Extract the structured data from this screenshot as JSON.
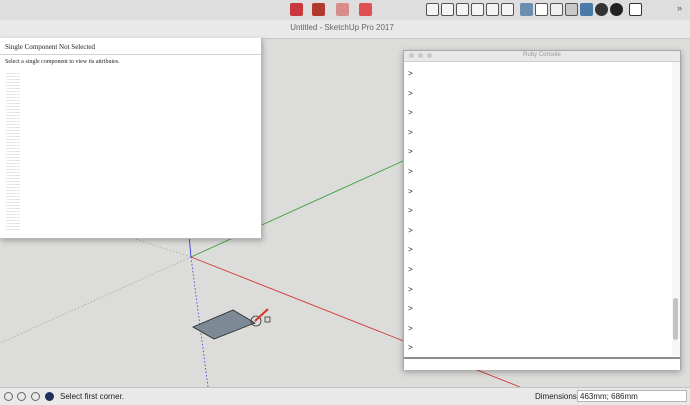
{
  "window": {
    "title": "Untitled - SketchUp Pro 2017"
  },
  "toolbar": {
    "icons": [
      "extension-warehouse-icon",
      "component-icon",
      "3d-warehouse-icon",
      "send-to-layout-icon",
      "iso-view-icon",
      "top-view-icon",
      "front-view-icon",
      "right-view-icon",
      "back-view-icon",
      "left-view-icon",
      "xray-icon",
      "wireframe-icon",
      "hidden-line-icon",
      "shaded-icon",
      "shaded-textures-icon",
      "monochrome-icon",
      "shadow-icon"
    ]
  },
  "attributes_panel": {
    "title": "Single Component Not Selected",
    "message": "Select a single component to view its attributes."
  },
  "ruby_console": {
    "title": "Ruby Console",
    "prompts": [
      ">",
      ">",
      ">",
      ">",
      ">",
      ">",
      ">",
      ">",
      ">",
      ">",
      ">",
      ">",
      ">",
      ">",
      ">"
    ]
  },
  "status_bar": {
    "message": "Select first corner.",
    "dimensions_label": "Dimensions",
    "dimensions_value": "463mm; 686mm"
  },
  "colors": {
    "x_axis": "#d33a3a",
    "y_axis": "#3fa03f",
    "z_axis": "#3a3ad8",
    "rectangle_fill": "#7d8a96",
    "pencil": "#d9382e"
  }
}
